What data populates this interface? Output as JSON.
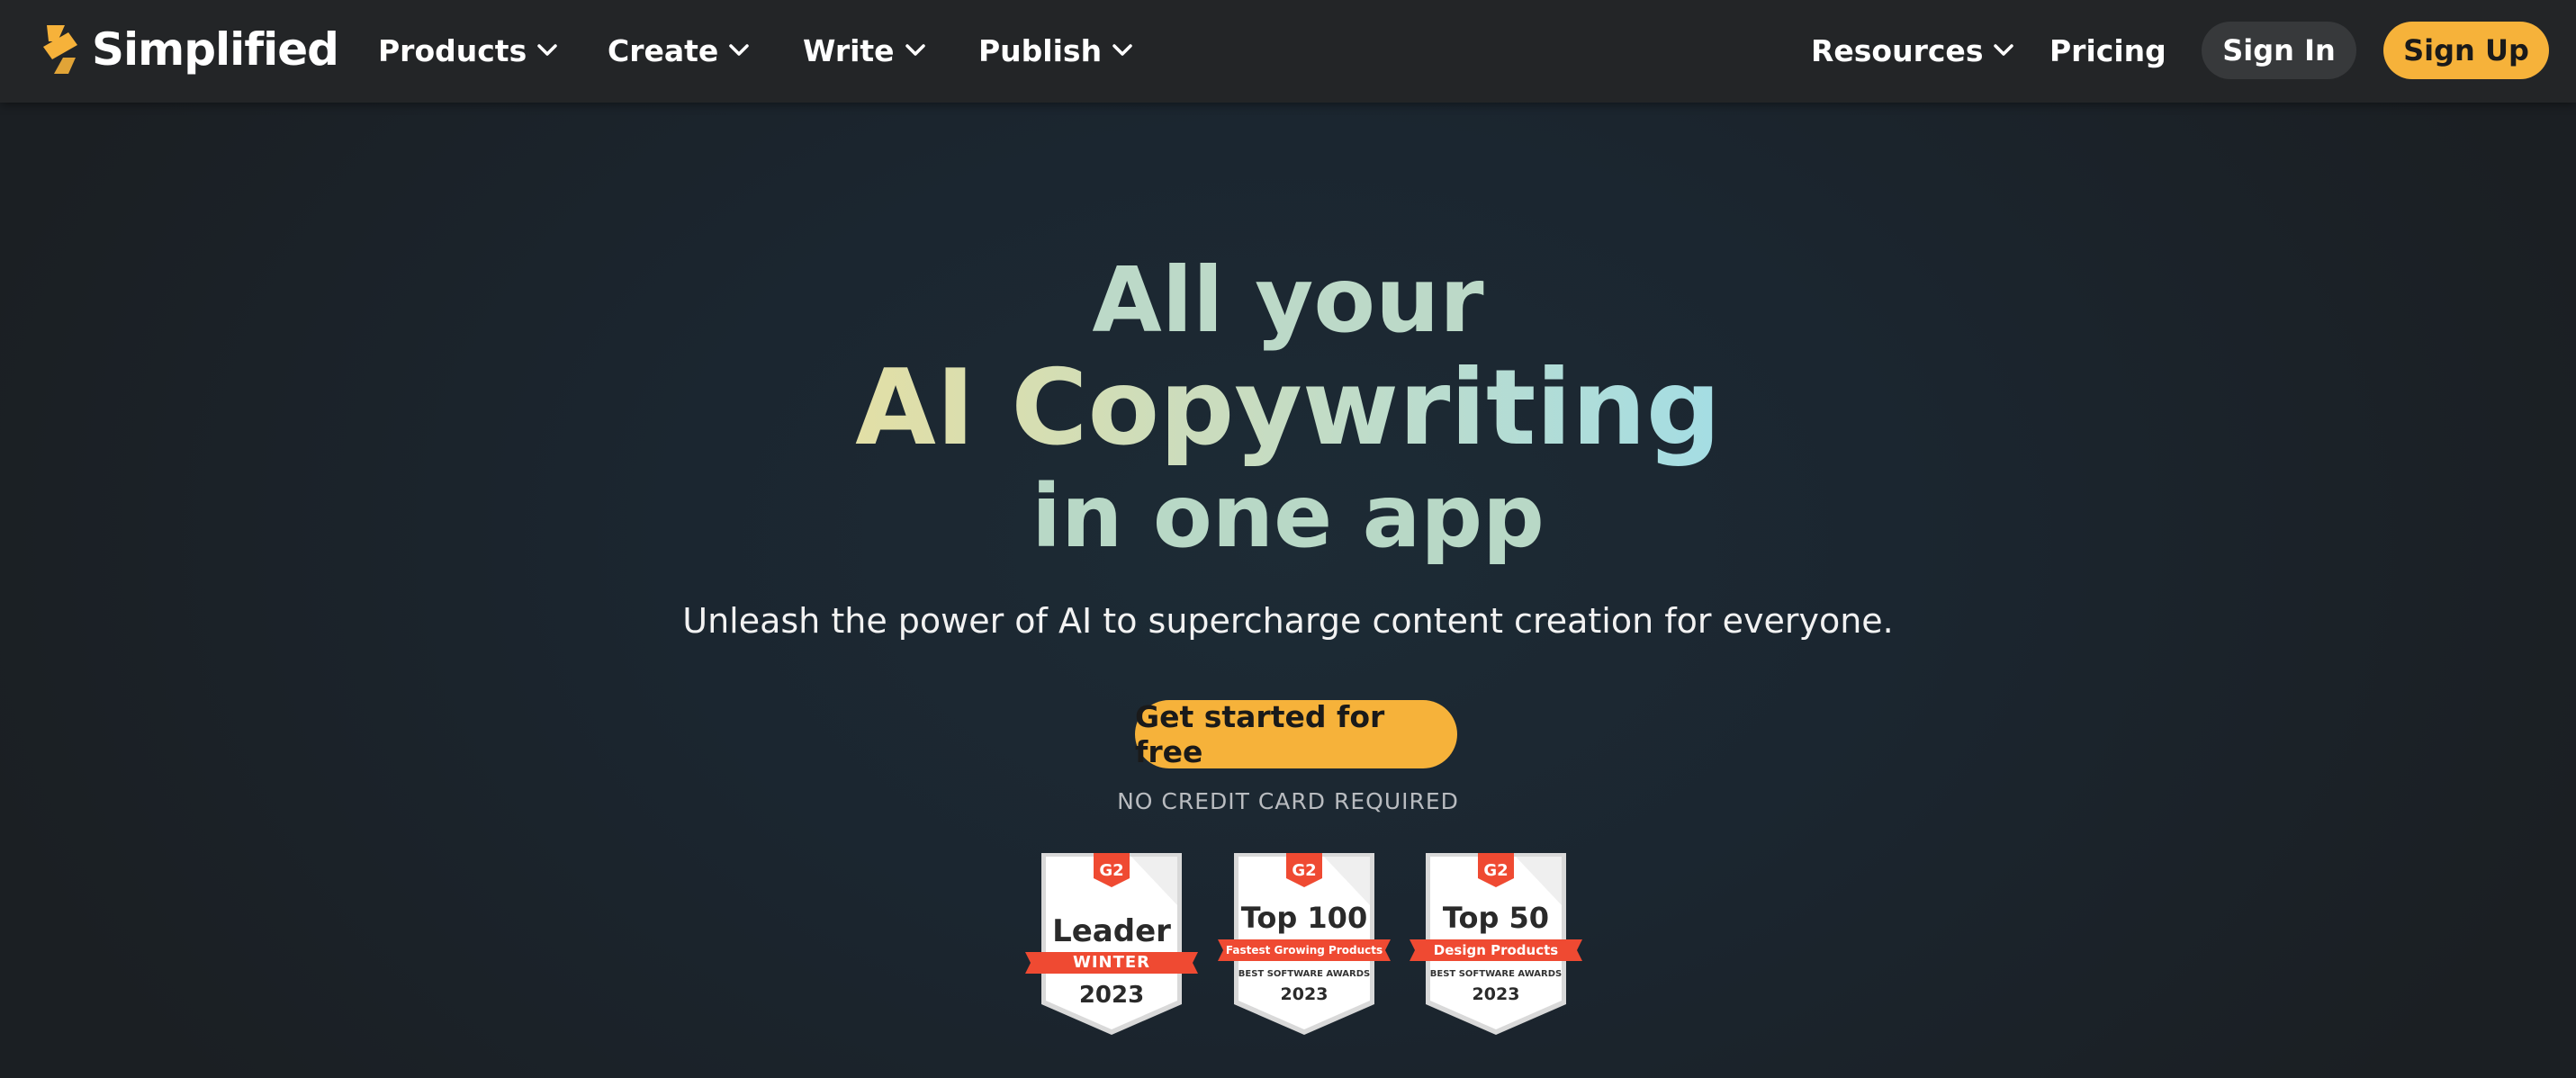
{
  "header": {
    "logo_text": "Simplified",
    "nav": [
      {
        "label": "Products"
      },
      {
        "label": "Create"
      },
      {
        "label": "Write"
      },
      {
        "label": "Publish"
      },
      {
        "label": "Resources"
      },
      {
        "label": "Pricing"
      }
    ],
    "sign_in": "Sign In",
    "sign_up": "Sign Up"
  },
  "hero": {
    "line1": "All your",
    "line2": "AI Copywriting",
    "line3": "in one app",
    "subtitle": "Unleash the power of AI to supercharge content creation for everyone.",
    "cta": "Get started for free",
    "note": "NO CREDIT CARD REQUIRED"
  },
  "badges": [
    {
      "logo": "G2",
      "title": "Leader",
      "ribbon": "WINTER",
      "year": "2023"
    },
    {
      "logo": "G2",
      "title": "Top 100",
      "ribbon": "Fastest Growing Products",
      "sub": "BEST SOFTWARE AWARDS",
      "year": "2023"
    },
    {
      "logo": "G2",
      "title": "Top 50",
      "ribbon": "Design Products",
      "sub": "BEST SOFTWARE AWARDS",
      "year": "2023"
    }
  ],
  "colors": {
    "accent": "#f6b23a",
    "navbar": "#232527",
    "g2_red": "#ef4a32",
    "heading_mint": "#bcd9c8",
    "gradient_start": "#e2dfa6",
    "gradient_end": "#a4dde4"
  },
  "icons": {
    "logo": "simplified-bolt-icon",
    "dropdown": "chevron-down-icon",
    "badge_logo": "g2-logo-icon"
  }
}
